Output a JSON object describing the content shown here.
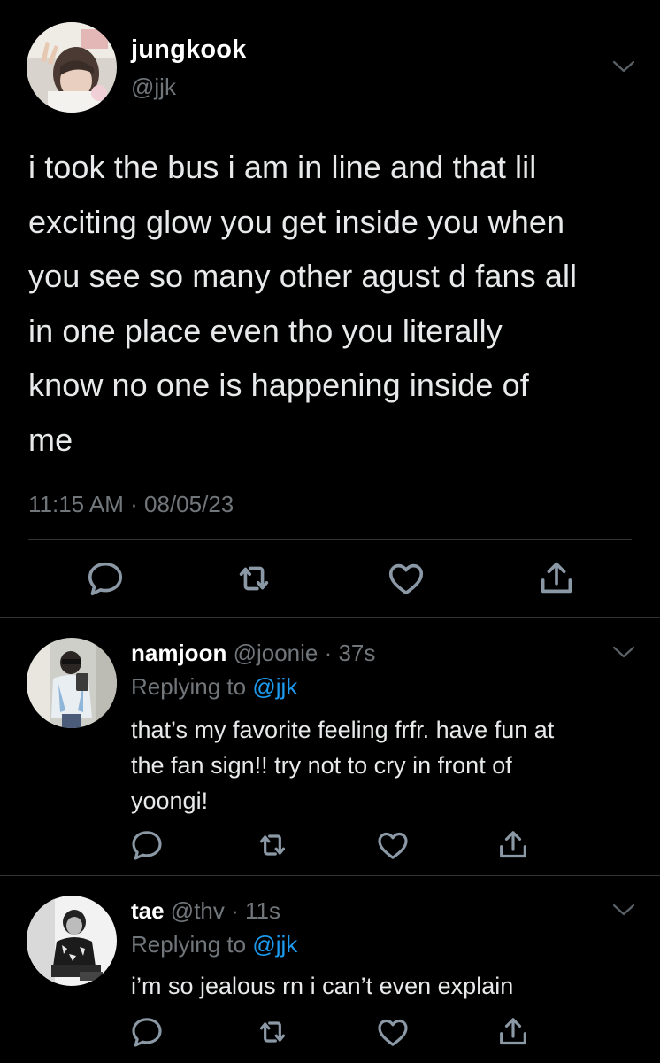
{
  "main_tweet": {
    "author_name": "jungkook",
    "author_handle": "@jjk",
    "text_lines": [
      "i took the bus i am in line and that lil",
      "exciting glow you get inside you when",
      "you see so many other agust d fans all",
      "in one place even tho you literally",
      "know no one is happening inside of",
      "me"
    ],
    "timestamp": "11:15 AM · 08/05/23"
  },
  "replies": [
    {
      "author_name": "namjoon",
      "meta": " @joonie · 37s",
      "replying_prefix": "Replying to ",
      "replying_mention": "@jjk",
      "text_lines": [
        "that’s my favorite feeling frfr. have fun at",
        "the fan sign!! try not to cry in front of",
        "yoongi!"
      ]
    },
    {
      "author_name": "tae",
      "meta": " @thv · 11s",
      "replying_prefix": "Replying to ",
      "replying_mention": "@jjk",
      "text_lines": [
        "i’m so jealous rn i can’t even explain"
      ]
    }
  ],
  "icons": {
    "reply": "reply-icon",
    "retweet": "retweet-icon",
    "like": "heart-icon",
    "share": "share-icon",
    "more": "chevron-down-icon"
  },
  "colors": {
    "background": "#000000",
    "text": "#e7e9ea",
    "secondary": "#71767b",
    "mention": "#1d9bf0",
    "divider": "#2f3336"
  }
}
